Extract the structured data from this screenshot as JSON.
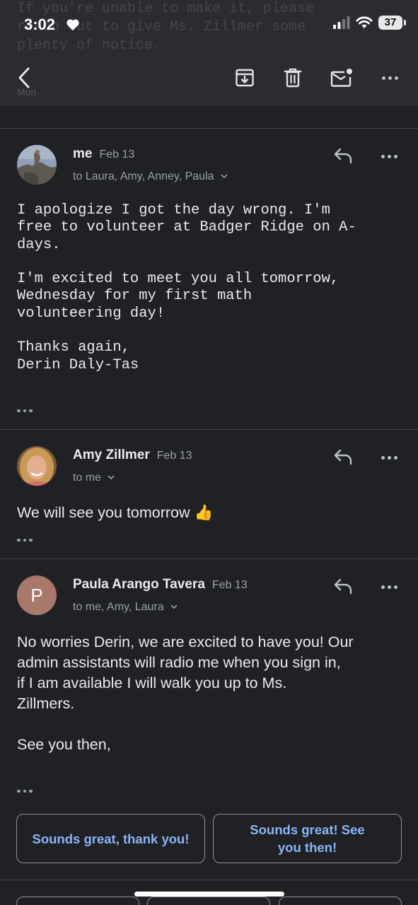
{
  "status_bar": {
    "time": "3:02",
    "battery": "37",
    "background_text": "If you're unable to make it, please\nreach out to give Ms. Zillmer some\nplenty of notice."
  },
  "toolbar": {
    "back_icon": "chevron-left-icon",
    "archive_icon": "archive-icon",
    "delete_icon": "trash-icon",
    "mark_unread_icon": "mail-unread-icon",
    "more_icon": "more-horizontal-icon",
    "ghost_label": "Mon"
  },
  "messages": [
    {
      "sender": "me",
      "date": "Feb 13",
      "recipients": "to Laura, Amy, Anney, Paula",
      "body": "I apologize I got the day wrong. I'm\nfree to volunteer at Badger Ridge on A-\ndays.\n\nI'm excited to meet you all tomorrow,\nWednesday for my first math\nvolunteering day!\n\nThanks again,\nDerin Daly-Tas"
    },
    {
      "sender": "Amy Zillmer",
      "date": "Feb 13",
      "recipients": "to me",
      "body": "We will see you tomorrow 👍"
    },
    {
      "sender": "Paula Arango Tavera",
      "date": "Feb 13",
      "recipients": "to me, Amy, Laura",
      "avatar_letter": "P",
      "body": "No worries Derin, we are excited to have you! Our\nadmin assistants will radio me when you sign in,\nif I am available I will walk you up to Ms.\nZillmers.\n\nSee you then,"
    }
  ],
  "smart_replies": [
    "Sounds great, thank you!",
    "Sounds great! See\nyou then!"
  ],
  "colors": {
    "background": "#202124",
    "bar": "#2b2c30",
    "link": "#8ab4f8",
    "avatar_p": "#a8786a"
  }
}
